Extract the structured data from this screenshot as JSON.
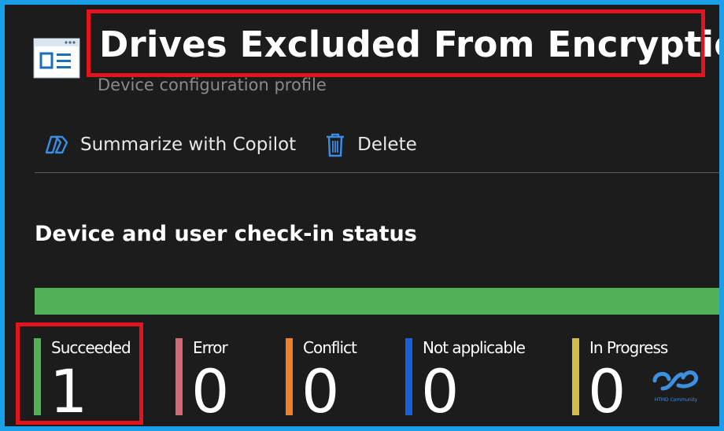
{
  "header": {
    "title": "Drives Excluded From Encryption",
    "subtitle": "Device configuration profile",
    "icon": "profile-window-icon"
  },
  "toolbar": {
    "copilot_label": "Summarize with Copilot",
    "copilot_icon": "copilot-icon",
    "delete_label": "Delete",
    "delete_icon": "trash-icon"
  },
  "section": {
    "title": "Device and user check-in status"
  },
  "progress": {
    "succeeded_fraction": 1.0,
    "fill_color": "#52b156"
  },
  "statuses": [
    {
      "label": "Succeeded",
      "count": "1",
      "color": "#52b156"
    },
    {
      "label": "Error",
      "count": "0",
      "color": "#d06a75"
    },
    {
      "label": "Conflict",
      "count": "0",
      "color": "#f07f2a"
    },
    {
      "label": "Not applicable",
      "count": "0",
      "color": "#1a5fd8"
    },
    {
      "label": "In Progress",
      "count": "0",
      "color": "#d4bb4a"
    }
  ],
  "watermark": {
    "text": "HTMD Community",
    "icon": "htmd-logo-icon"
  },
  "colors": {
    "accent": "#3d8fe0",
    "highlight": "#e3141d",
    "frame": "#1b9fe8"
  }
}
